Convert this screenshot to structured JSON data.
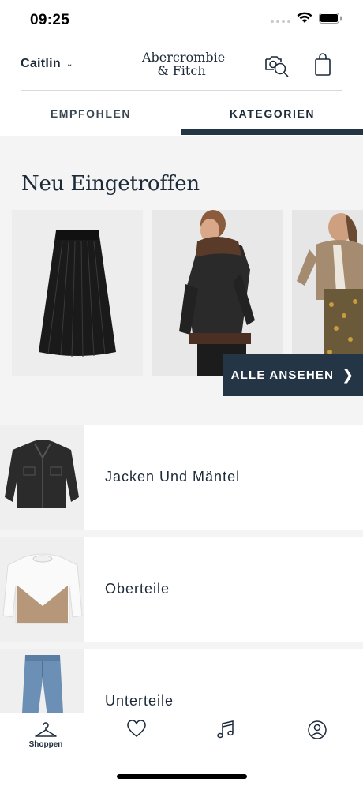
{
  "status_bar": {
    "time": "09:25"
  },
  "header": {
    "user_name": "Caitlin",
    "logo_line1": "Abercrombie",
    "logo_line2": "& Fitch"
  },
  "tabs": [
    {
      "label": "EMPFOHLEN",
      "active": false
    },
    {
      "label": "KATEGORIEN",
      "active": true
    }
  ],
  "new_arrivals": {
    "title": "Neu Eingetroffen",
    "see_all_label": "ALLE ANSEHEN",
    "items": [
      {
        "image": "pleated-black-skirt"
      },
      {
        "image": "model-black-shearling-jacket"
      },
      {
        "image": "model-tan-shearling-coat"
      }
    ]
  },
  "categories": [
    {
      "label": "Jacken Und Mäntel",
      "image": "black-denim-jacket"
    },
    {
      "label": "Oberteile",
      "image": "white-beige-sweater"
    },
    {
      "label": "Unterteile",
      "image": "blue-jeans"
    }
  ],
  "bottom_nav": [
    {
      "label": "Shoppen",
      "icon": "hanger-icon",
      "active": true
    },
    {
      "label": "",
      "icon": "heart-icon"
    },
    {
      "label": "",
      "icon": "music-icon"
    },
    {
      "label": "",
      "icon": "account-icon"
    }
  ],
  "colors": {
    "primary": "#243646",
    "text": "#1c2a3a",
    "background": "#f4f4f4"
  }
}
